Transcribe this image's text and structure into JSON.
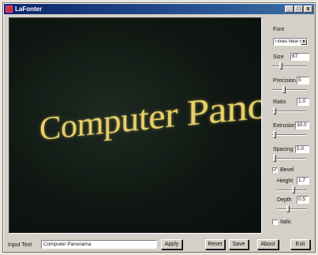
{
  "window": {
    "title": "LaFonter",
    "min_glyph": "_",
    "max_glyph": "□",
    "close_glyph": "x",
    "app_icon": "app-icon",
    "title_bar_color": "#0a246a"
  },
  "canvas": {
    "rendered_text": "Computer Panoı",
    "text_color": "#e7d16a",
    "background_color": "#101712"
  },
  "panel": {
    "font_label": "Font",
    "font_value": "Times New Rom",
    "size_label": "Size",
    "size_value": "67",
    "precision_label": "Precision",
    "precision_value": "5",
    "ratio_label": "Ratio",
    "ratio_value": "1.0",
    "extrusion_label": "Extrusion",
    "extrusion_value": "30.0",
    "spacing_label": "Spacing",
    "spacing_value": "5.0",
    "bevel_label": "Bevel",
    "bevel_checked": true,
    "bevel_check_glyph": "✓",
    "height_label": "Height",
    "height_value": "1.7",
    "depth_label": "Depth",
    "depth_value": "0.5",
    "italic_label": "Italic",
    "italic_checked": false
  },
  "sliders": {
    "size": 0.25,
    "precision": 0.35,
    "ratio": 0.05,
    "extrusion": 0.05,
    "spacing": 0.05,
    "height": 0.55,
    "depth": 0.35
  },
  "bottom": {
    "input_label": "Input Text",
    "input_value": "Computer Panorama",
    "apply_label": "Apply",
    "reset_label": "Reset",
    "save_label": "Save",
    "about_label": "About",
    "exit_label": "Exit"
  }
}
